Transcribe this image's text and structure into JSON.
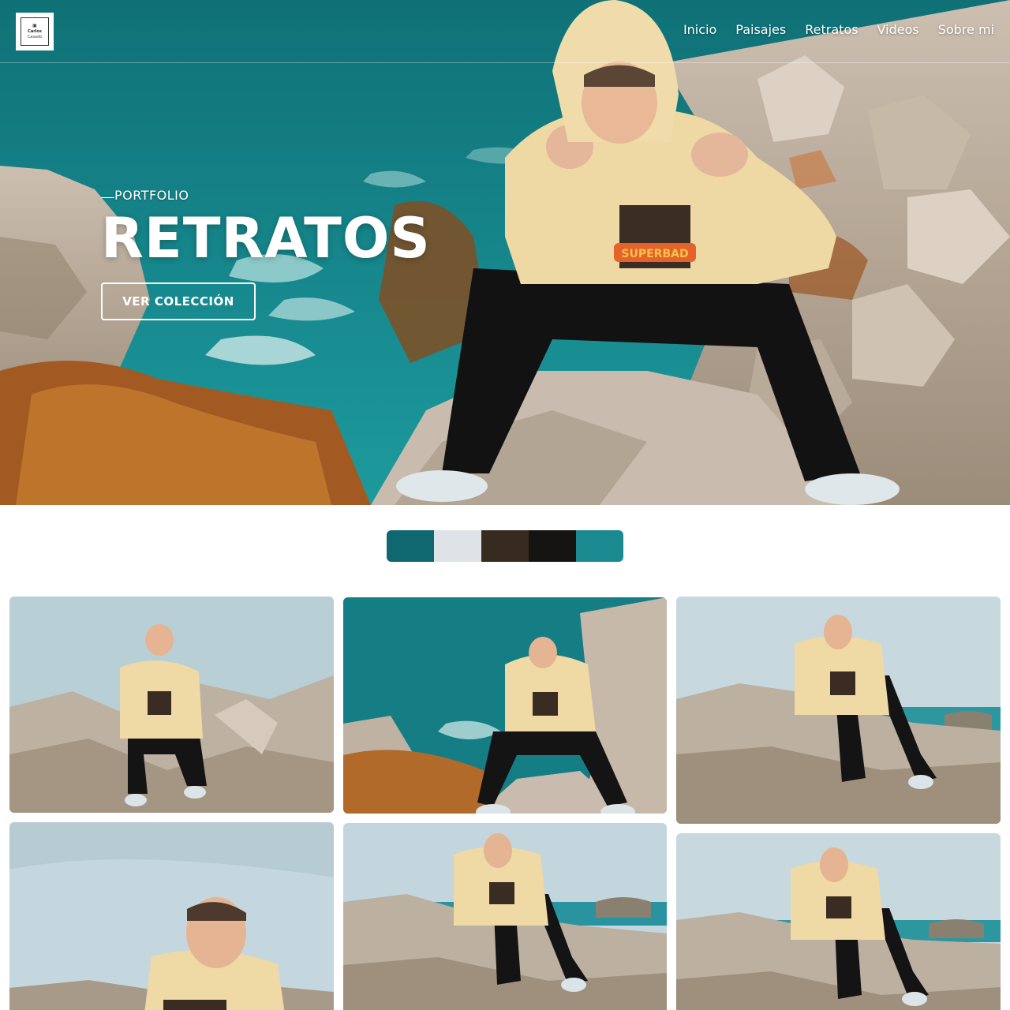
{
  "brand": {
    "logo_line1": "Carlos",
    "logo_line2": "Casado"
  },
  "nav": {
    "items": [
      {
        "label": "Inicio"
      },
      {
        "label": "Paisajes"
      },
      {
        "label": "Retratos"
      },
      {
        "label": "Videos"
      },
      {
        "label": "Sobre mi"
      }
    ]
  },
  "hero": {
    "kicker": "PORTFOLIO",
    "title": "RETRATOS",
    "cta_label": "VER COLECCIÓN",
    "hoodie_print": "SUPERBAD"
  },
  "palette": {
    "colors": [
      "#0f6770",
      "#dde3e6",
      "#372b1f",
      "#151412",
      "#1a8a90"
    ]
  },
  "gallery": {
    "photos": [
      {
        "subject": "man-sitting-on-rocks"
      },
      {
        "subject": "man-hand-signs-by-sea"
      },
      {
        "subject": "man-reclining-on-rocks"
      },
      {
        "subject": "man-closeup-portrait"
      },
      {
        "subject": "man-reclining-on-rocks"
      },
      {
        "subject": "man-reclining-on-rocks"
      }
    ]
  },
  "colors": {
    "sea": "#1a8c90",
    "hoodie": "#efd9a4",
    "rock": "#b7aa99",
    "sky": "#c9dbe2",
    "text": "#ffffff"
  }
}
